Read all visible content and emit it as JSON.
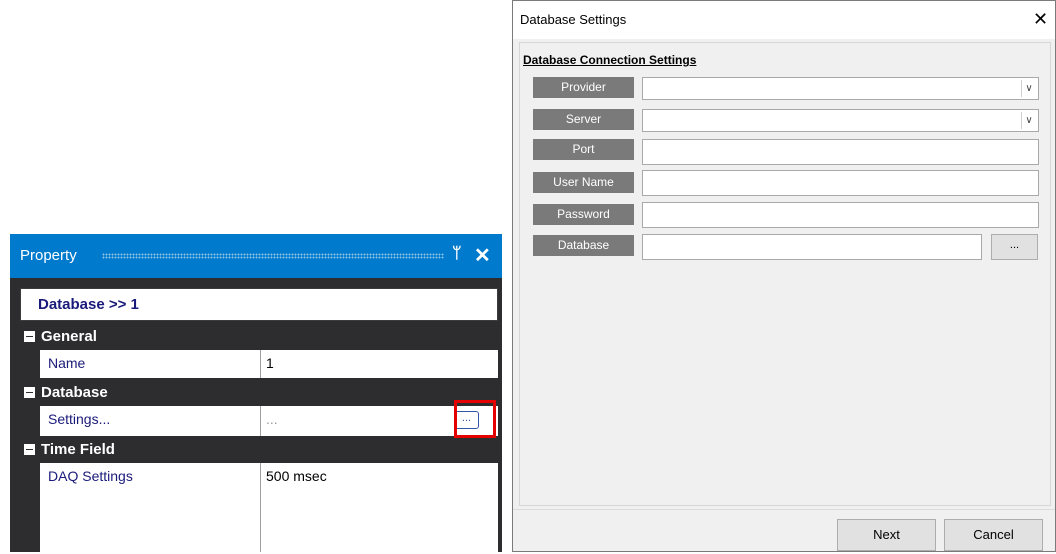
{
  "property_panel": {
    "title": "Property",
    "pin_glyph": "ᛘ",
    "close_glyph": "✕",
    "header": "Database >> 1",
    "categories": {
      "general": {
        "label": "General",
        "rows": [
          {
            "name": "Name",
            "value": "1"
          }
        ]
      },
      "database": {
        "label": "Database",
        "rows": [
          {
            "name": "Settings...",
            "value": "..."
          }
        ]
      },
      "time_field": {
        "label": "Time Field",
        "rows": [
          {
            "name": "DAQ Settings",
            "value": "500 msec"
          }
        ]
      }
    },
    "ellipsis_button": "..."
  },
  "dialog": {
    "title": "Database Settings",
    "close_glyph": "✕",
    "group_title": "Database Connection Settings",
    "fields": {
      "provider": {
        "label": "Provider",
        "value": ""
      },
      "server": {
        "label": "Server",
        "value": ""
      },
      "port": {
        "label": "Port",
        "value": ""
      },
      "user_name": {
        "label": "User Name",
        "value": ""
      },
      "password": {
        "label": "Password",
        "value": ""
      },
      "database": {
        "label": "Database",
        "value": ""
      }
    },
    "browse_button": "...",
    "next_button": "Next",
    "cancel_button": "Cancel"
  },
  "colors": {
    "title_bar": "#007acc",
    "panel_dark": "#2d2d30",
    "highlight": "#e50000",
    "label_bg": "#7a7a7a"
  }
}
